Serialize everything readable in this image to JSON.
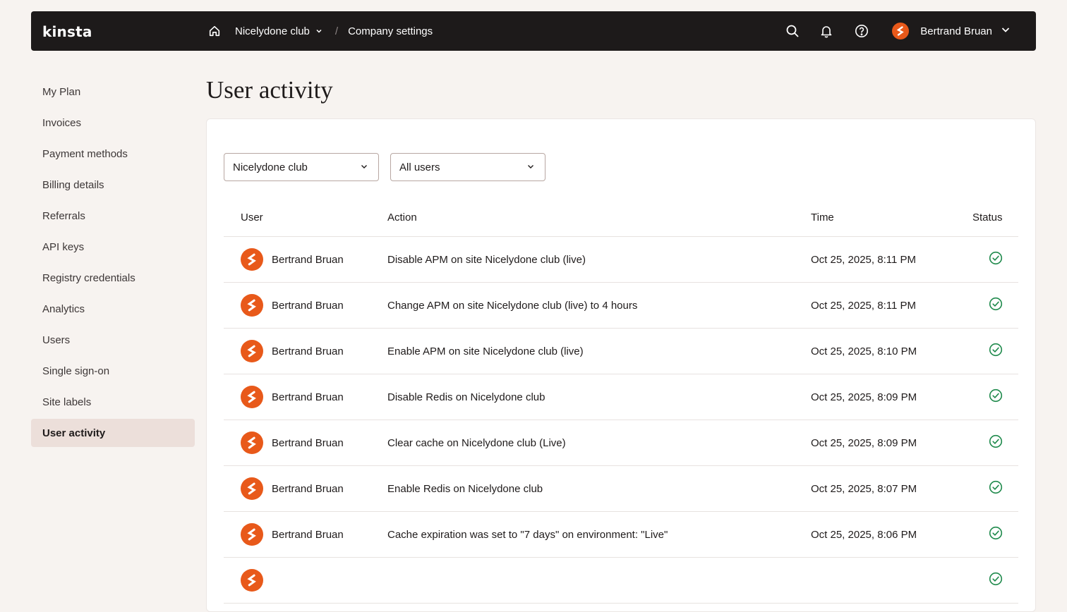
{
  "app": {
    "logo": "kinsta"
  },
  "header": {
    "breadcrumb": [
      {
        "label": "Nicelydone club",
        "has_dropdown": true
      },
      {
        "label": "Company settings",
        "has_dropdown": false
      }
    ],
    "separator": "/",
    "user_name": "Bertrand Bruan",
    "icons": [
      "home-icon",
      "search-icon",
      "bell-icon",
      "help-icon",
      "chevron-down-icon"
    ]
  },
  "sidebar": {
    "items": [
      {
        "label": "My Plan",
        "active": false
      },
      {
        "label": "Invoices",
        "active": false
      },
      {
        "label": "Payment methods",
        "active": false
      },
      {
        "label": "Billing details",
        "active": false
      },
      {
        "label": "Referrals",
        "active": false
      },
      {
        "label": "API keys",
        "active": false
      },
      {
        "label": "Registry credentials",
        "active": false
      },
      {
        "label": "Analytics",
        "active": false
      },
      {
        "label": "Users",
        "active": false
      },
      {
        "label": "Single sign-on",
        "active": false
      },
      {
        "label": "Site labels",
        "active": false
      },
      {
        "label": "User activity",
        "active": true
      }
    ]
  },
  "main": {
    "title": "User activity",
    "filters": {
      "company": "Nicelydone club",
      "users": "All users"
    },
    "table": {
      "headers": {
        "user": "User",
        "action": "Action",
        "time": "Time",
        "status": "Status"
      },
      "rows": [
        {
          "user": "Bertrand Bruan",
          "action": "Disable APM on site Nicelydone club (live)",
          "time": "Oct 25, 2025, 8:11 PM",
          "status": "success"
        },
        {
          "user": "Bertrand Bruan",
          "action": "Change APM on site Nicelydone club (live) to 4 hours",
          "time": "Oct 25, 2025, 8:11 PM",
          "status": "success"
        },
        {
          "user": "Bertrand Bruan",
          "action": "Enable APM on site Nicelydone club (live)",
          "time": "Oct 25, 2025, 8:10 PM",
          "status": "success"
        },
        {
          "user": "Bertrand Bruan",
          "action": "Disable Redis on Nicelydone club",
          "time": "Oct 25, 2025, 8:09 PM",
          "status": "success"
        },
        {
          "user": "Bertrand Bruan",
          "action": "Clear cache on Nicelydone club (Live)",
          "time": "Oct 25, 2025, 8:09 PM",
          "status": "success"
        },
        {
          "user": "Bertrand Bruan",
          "action": "Enable Redis on Nicelydone club",
          "time": "Oct 25, 2025, 8:07 PM",
          "status": "success"
        },
        {
          "user": "Bertrand Bruan",
          "action": "Cache expiration was set to \"7 days\" on environment: \"Live\"",
          "time": "Oct 25, 2025, 8:06 PM",
          "status": "success"
        },
        {
          "user": "",
          "action": "",
          "time": "",
          "status": "success"
        }
      ]
    }
  },
  "colors": {
    "topbar": "#1d1a1a",
    "accent": "#e8591a",
    "success": "#1f8a4c",
    "page_bg": "#f7f3f0",
    "active_item_bg": "#ecdfda"
  }
}
